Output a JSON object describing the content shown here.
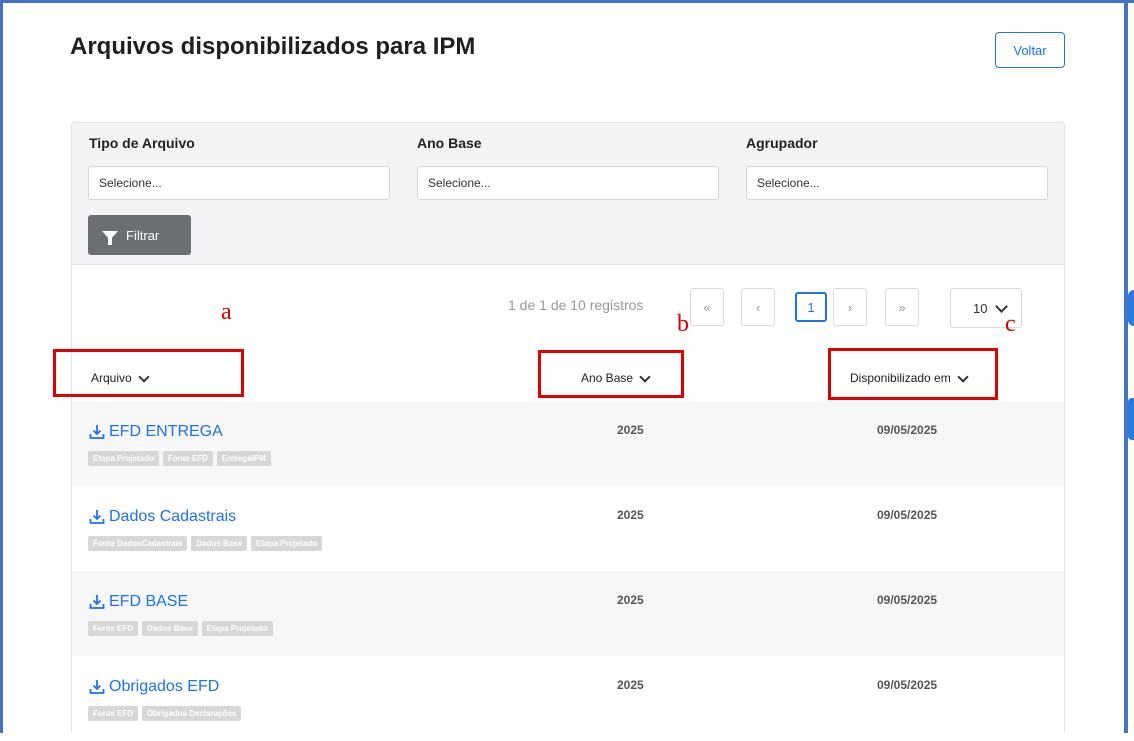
{
  "page": {
    "title": "Arquivos disponibilizados para IPM",
    "back_label": "Voltar"
  },
  "filters": {
    "tipo": {
      "label": "Tipo de Arquivo",
      "placeholder": "Selecione..."
    },
    "ano": {
      "label": "Ano Base",
      "placeholder": "Selecione..."
    },
    "agrupador": {
      "label": "Agrupador",
      "placeholder": "Selecione..."
    },
    "button_label": "Filtrar"
  },
  "pagination": {
    "info": "1 de 1 de 10 registros",
    "first": "«",
    "prev": "‹",
    "current": "1",
    "next": "›",
    "last": "»",
    "per_page": "10"
  },
  "annotations": {
    "a": "a",
    "b": "b",
    "c": "c",
    "color": "#dd0000"
  },
  "table": {
    "columns": [
      "Arquivo",
      "Ano Base",
      "Disponibilizado em"
    ],
    "rows": [
      {
        "name": "EFD ENTREGA",
        "tags": [
          "Etapa Projetado",
          "Fonte EFD",
          "EntregaIPM"
        ],
        "year": "2025",
        "date": "09/05/2025"
      },
      {
        "name": "Dados Cadastrais",
        "tags": [
          "Fonte DadosCadastrais",
          "Dados Base",
          "Etapa Projetado"
        ],
        "year": "2025",
        "date": "09/05/2025"
      },
      {
        "name": "EFD BASE",
        "tags": [
          "Fonte EFD",
          "Dados Base",
          "Etapa Projetado"
        ],
        "year": "2025",
        "date": "09/05/2025"
      },
      {
        "name": "Obrigados EFD",
        "tags": [
          "Fonte EFD",
          "Obrigados Declarações"
        ],
        "year": "2025",
        "date": "09/05/2025"
      }
    ]
  },
  "colors": {
    "accent": "#1e73e8",
    "filter_button": "#6b6f73",
    "frame": "#4472c4"
  },
  "icons": {
    "file": "download-icon",
    "filter": "funnel-icon",
    "sort": "chevron-down-icon"
  }
}
